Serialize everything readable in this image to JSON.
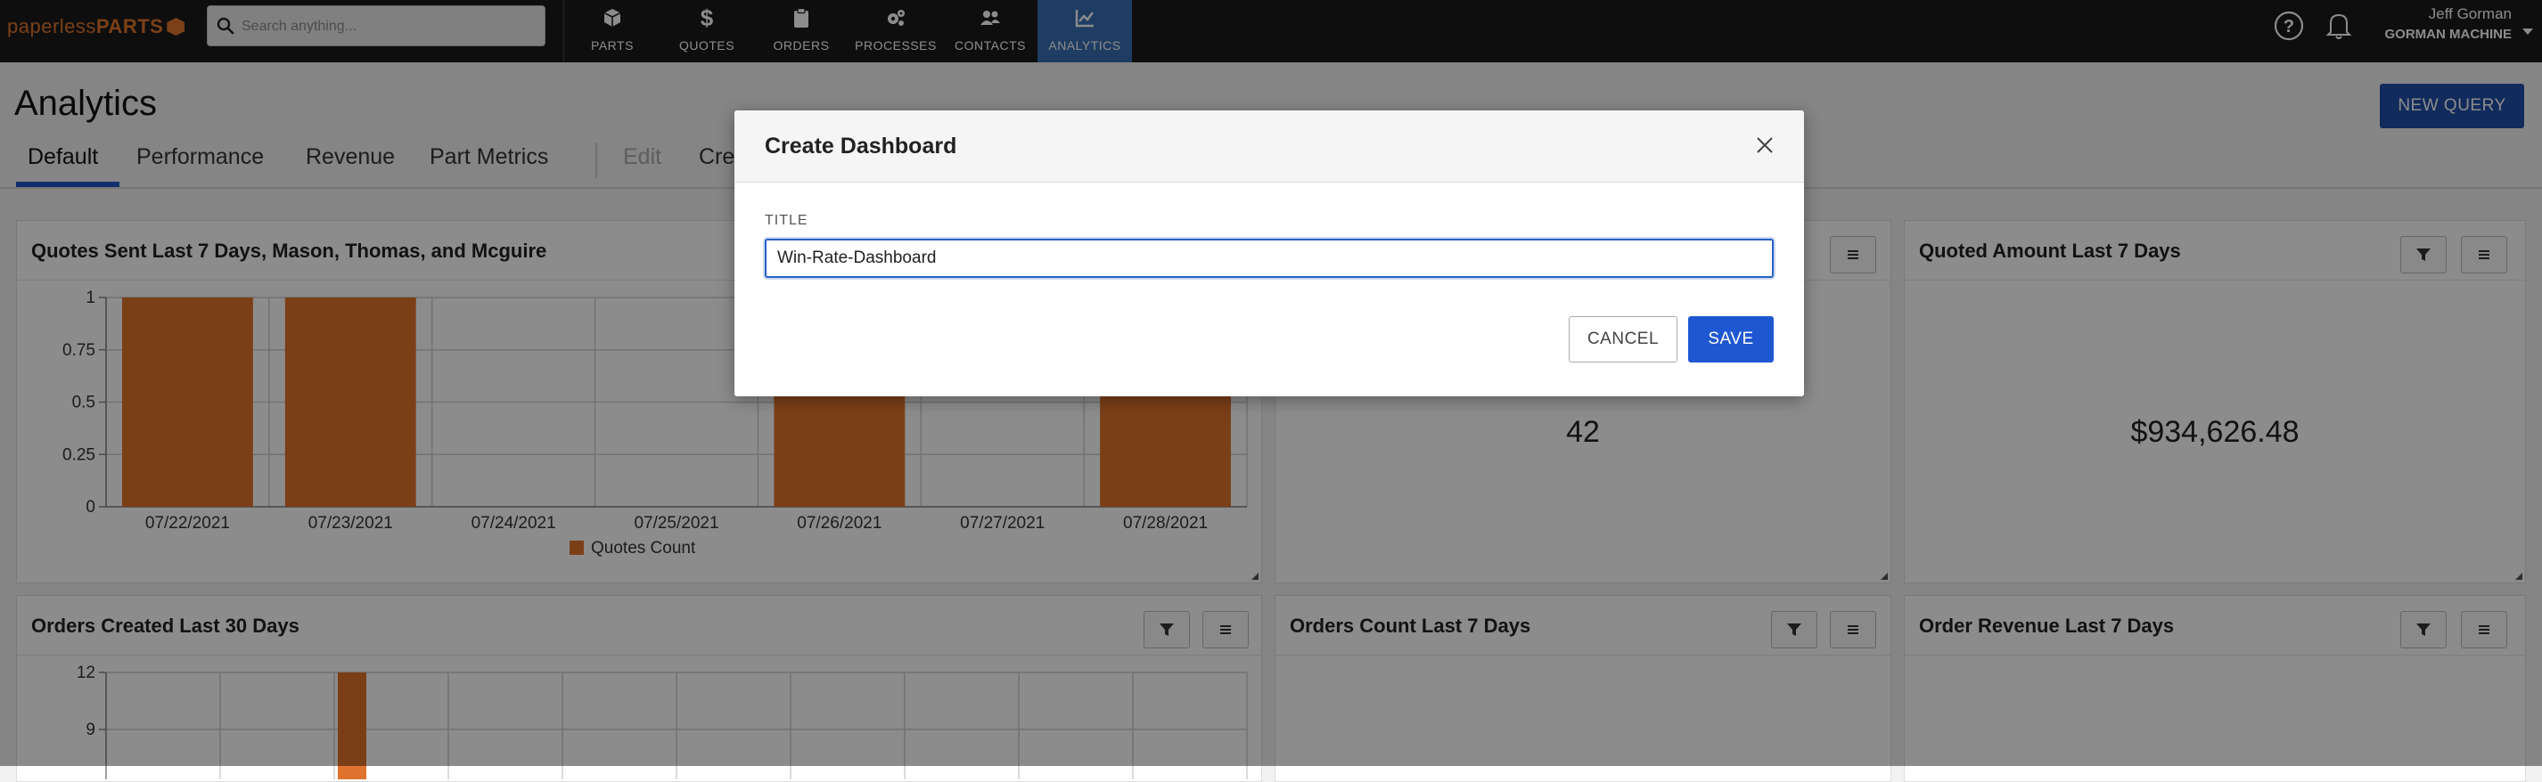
{
  "app": {
    "logo_light": "paperless",
    "logo_bold": "PARTS"
  },
  "search": {
    "placeholder": "Search anything..."
  },
  "nav": [
    {
      "label": "PARTS",
      "icon": "box-icon"
    },
    {
      "label": "QUOTES",
      "icon": "dollar-icon"
    },
    {
      "label": "ORDERS",
      "icon": "clipboard-icon"
    },
    {
      "label": "PROCESSES",
      "icon": "gears-icon"
    },
    {
      "label": "CONTACTS",
      "icon": "people-icon"
    },
    {
      "label": "ANALYTICS",
      "icon": "chart-line-icon",
      "active": true
    }
  ],
  "user": {
    "name": "Jeff Gorman",
    "company": "GORMAN MACHINE"
  },
  "page": {
    "title": "Analytics",
    "new_query_label": "NEW QUERY",
    "tabs": [
      "Default",
      "Performance",
      "Revenue",
      "Part Metrics"
    ],
    "tab_edit": "Edit",
    "tab_create_partial": "Cre"
  },
  "panels": {
    "quotes_sent": {
      "title": "Quotes Sent Last 7 Days, Mason, Thomas, and Mcguire"
    },
    "quotes_count": {
      "value": "42"
    },
    "quoted_amount": {
      "title": "Quoted Amount Last 7 Days",
      "value": "$934,626.48"
    },
    "orders_created": {
      "title": "Orders Created Last 30 Days"
    },
    "orders_count": {
      "title": "Orders Count Last 7 Days"
    },
    "order_revenue": {
      "title": "Order Revenue Last 7 Days"
    }
  },
  "chart_data": [
    {
      "type": "bar",
      "title": "Quotes Sent Last 7 Days, Mason, Thomas, and Mcguire",
      "categories": [
        "07/22/2021",
        "07/23/2021",
        "07/24/2021",
        "07/25/2021",
        "07/26/2021",
        "07/27/2021",
        "07/28/2021"
      ],
      "series": [
        {
          "name": "Quotes Count",
          "values": [
            1,
            1,
            0,
            0,
            1,
            0,
            1
          ]
        }
      ],
      "yticks": [
        "0",
        "0.25",
        "0.5",
        "0.75",
        "1"
      ],
      "ylim": [
        0,
        1
      ],
      "grid": true,
      "legend": "bottom",
      "color": "#e0732d"
    },
    {
      "type": "bar",
      "title": "Orders Created Last 30 Days",
      "yticks_visible": [
        "12",
        "9"
      ],
      "ylim_top": 12,
      "grid": true,
      "color": "#e0732d"
    }
  ],
  "modal": {
    "title": "Create Dashboard",
    "field_label": "TITLE",
    "field_value": "Win-Rate-Dashboard",
    "cancel_label": "CANCEL",
    "save_label": "SAVE"
  },
  "colors": {
    "nav_bg": "#1b1b1b",
    "nav_active": "#3a6fb3",
    "primary": "#1f57d1",
    "bar": "#e0732d",
    "brand": "#e0762c"
  }
}
